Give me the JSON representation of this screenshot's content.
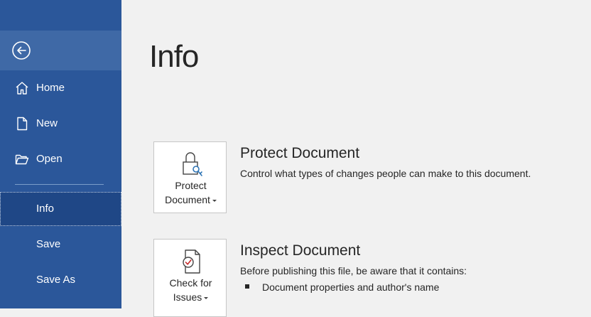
{
  "sidebar": {
    "back_icon": "back-arrow-icon",
    "items": [
      {
        "label": "Home",
        "icon": "home-icon"
      },
      {
        "label": "New",
        "icon": "new-document-icon"
      },
      {
        "label": "Open",
        "icon": "open-folder-icon"
      },
      {
        "label": "Info"
      },
      {
        "label": "Save"
      },
      {
        "label": "Save As"
      }
    ],
    "active": "Info",
    "colors": {
      "background": "#2b579a",
      "active": "#1f4786"
    }
  },
  "main": {
    "title": "Info",
    "sections": [
      {
        "tile_line1": "Protect",
        "tile_line2": "Document",
        "icon": "lock-key-icon",
        "heading": "Protect Document",
        "description": "Control what types of changes people can make to this document."
      },
      {
        "tile_line1": "Check for",
        "tile_line2": "Issues",
        "icon": "document-check-icon",
        "heading": "Inspect Document",
        "description": "Before publishing this file, be aware that it contains:",
        "bullets": [
          "Document properties and author's name"
        ]
      }
    ]
  }
}
